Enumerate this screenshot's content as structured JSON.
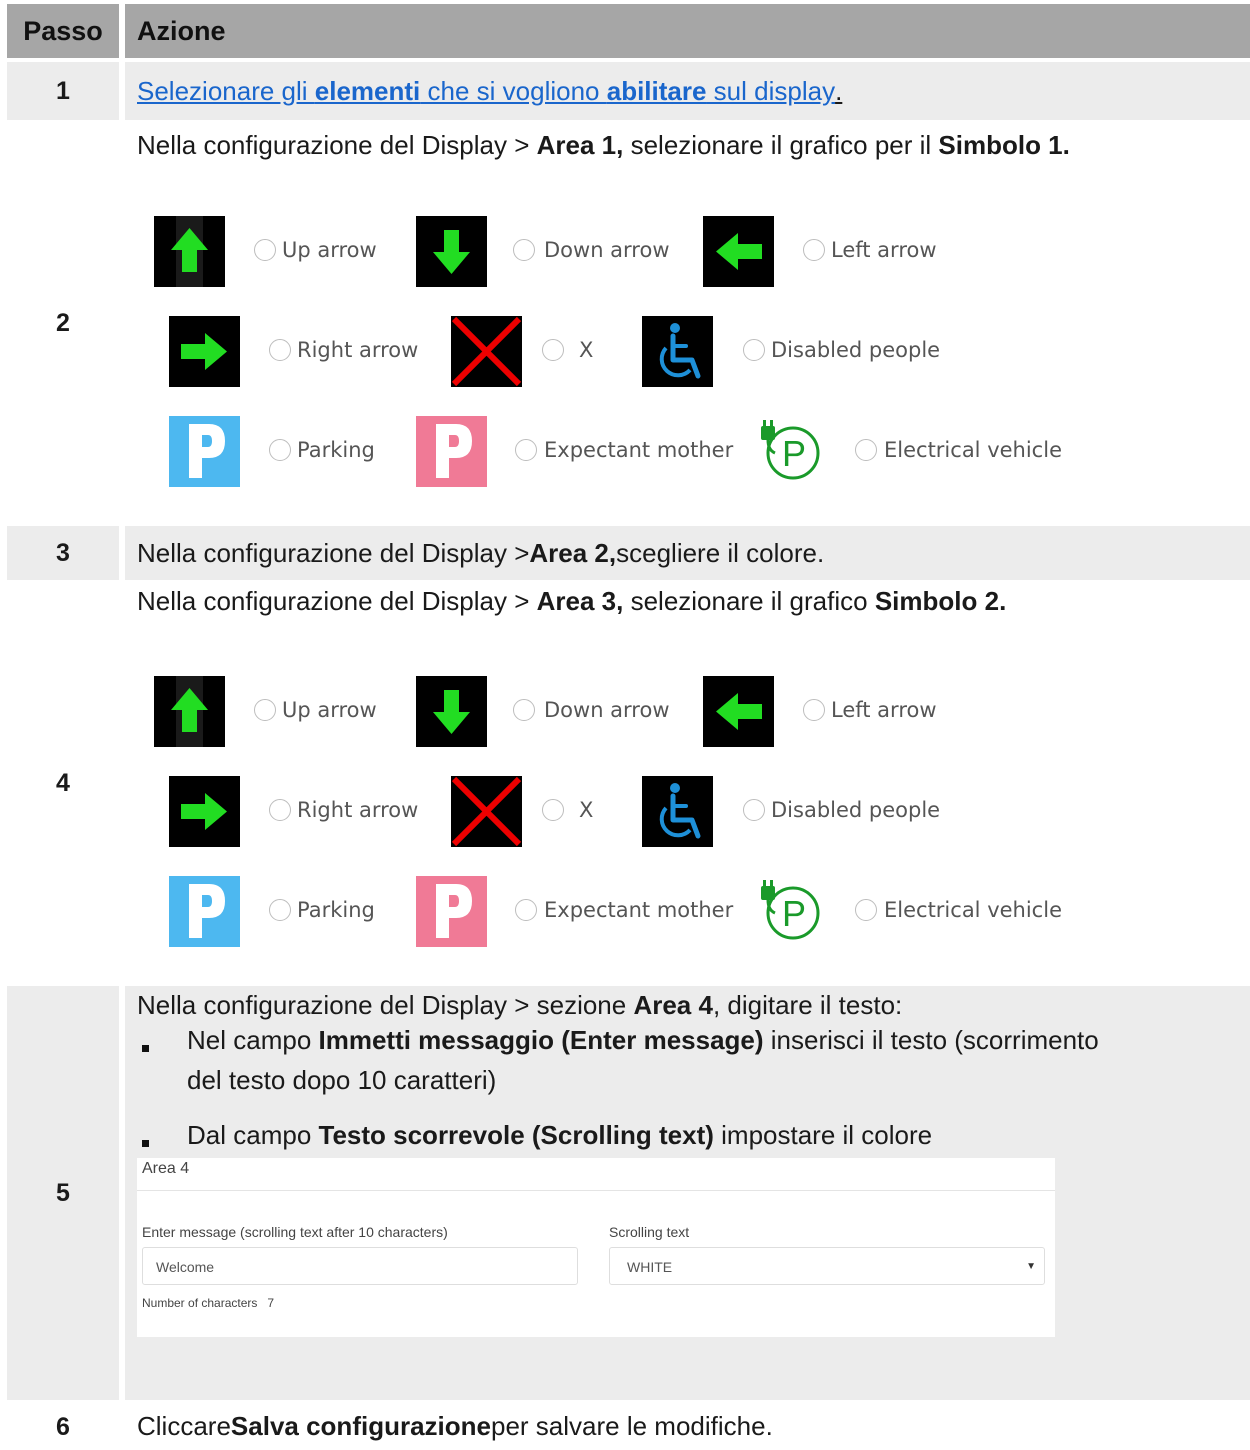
{
  "header": {
    "step": "Passo",
    "action": "Azione"
  },
  "step1": {
    "num": "1",
    "parts": [
      "Selezionare gli ",
      "elementi",
      " che si vogliono ",
      "abilitare",
      " sul display",
      "."
    ]
  },
  "step2": {
    "num": "2",
    "intro": [
      "Nella configurazione del Display > ",
      "Area 1,",
      " selezionare il grafico per il ",
      "Simbolo 1."
    ]
  },
  "step3": {
    "num": "3",
    "text": [
      "Nella configurazione del Display > ",
      "Area 2,",
      " scegliere il colore."
    ]
  },
  "step4": {
    "num": "4",
    "intro": [
      "Nella configurazione del Display > ",
      "Area 3,",
      " selezionare il grafico ",
      "Simbolo 2."
    ]
  },
  "symbols": {
    "up": "Up arrow",
    "down": "Down arrow",
    "left": "Left arrow",
    "right": "Right arrow",
    "x": "X",
    "disabled": "Disabled people",
    "parking": "Parking",
    "mother": "Expectant mother",
    "ev": "Electrical vehicle"
  },
  "step5": {
    "num": "5",
    "intro": [
      "Nella configurazione del Display > sezione ",
      "Area 4",
      ", digitare il testo:"
    ],
    "bullet1": [
      "Nel campo ",
      "Immetti messaggio (Enter message)",
      " inserisci il testo (scorrimento",
      "del testo dopo 10 caratteri)"
    ],
    "bullet2": [
      "Dal campo ",
      "Testo scorrevole (Scrolling text)",
      " impostare il colore"
    ],
    "panel": {
      "title": "Area 4",
      "message_label": "Enter message (scrolling text after 10 characters)",
      "message_value": "Welcome",
      "scroll_label": "Scrolling text",
      "scroll_value": "WHITE",
      "count_label": "Number of characters",
      "count_value": "7"
    }
  },
  "step6": {
    "num": "6",
    "text": [
      "Cliccare ",
      "Salva configurazione",
      " per salvare le modifiche."
    ]
  },
  "colors": {
    "arrow_green": "#22dd22",
    "x_red": "#ee0000",
    "disabled_blue": "#1e90d8",
    "parking_blue": "#4db8f0",
    "mother_pink": "#f07a96",
    "ev_green": "#1a9a2a"
  }
}
